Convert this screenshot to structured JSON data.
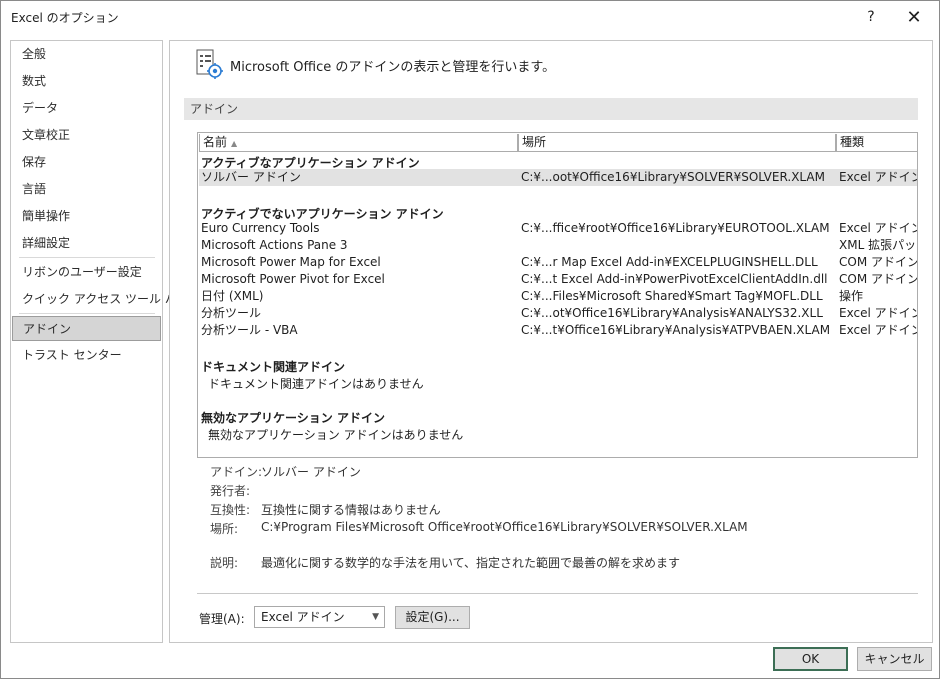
{
  "window": {
    "title": "Excel のオプション",
    "help_glyph": "?",
    "close_glyph": "✕"
  },
  "nav": {
    "items": [
      {
        "label": "全般"
      },
      {
        "label": "数式"
      },
      {
        "label": "データ"
      },
      {
        "label": "文章校正"
      },
      {
        "label": "保存"
      },
      {
        "label": "言語"
      },
      {
        "label": "簡単操作"
      },
      {
        "label": "詳細設定"
      },
      {
        "label": "リボンのユーザー設定"
      },
      {
        "label": "クイック アクセス ツール バー"
      },
      {
        "label": "アドイン",
        "active": true
      },
      {
        "label": "トラスト センター"
      }
    ]
  },
  "header": {
    "text": "Microsoft Office のアドインの表示と管理を行います。",
    "icon": "addin-settings-icon"
  },
  "section": {
    "title": "アドイン"
  },
  "table": {
    "columns": [
      "名前",
      "場所",
      "種類"
    ],
    "sort_indicator": "▲",
    "groups": {
      "active": {
        "title": "アクティブなアプリケーション アドイン",
        "rows": [
          {
            "name": "ソルバー アドイン",
            "location": "C:¥...oot¥Office16¥Library¥SOLVER¥SOLVER.XLAM",
            "type": "Excel アドイン",
            "selected": true
          }
        ]
      },
      "inactive": {
        "title": "アクティブでないアプリケーション アドイン",
        "rows": [
          {
            "name": "Euro Currency Tools",
            "location": "C:¥...ffice¥root¥Office16¥Library¥EUROTOOL.XLAM",
            "type": "Excel アドイン"
          },
          {
            "name": "Microsoft Actions Pane 3",
            "location": "",
            "type": "XML 拡張パック"
          },
          {
            "name": "Microsoft Power Map for Excel",
            "location": "C:¥...r Map Excel Add-in¥EXCELPLUGINSHELL.DLL",
            "type": "COM アドイン"
          },
          {
            "name": "Microsoft Power Pivot for Excel",
            "location": "C:¥...t Excel Add-in¥PowerPivotExcelClientAddIn.dll",
            "type": "COM アドイン"
          },
          {
            "name": "日付 (XML)",
            "location": "C:¥...Files¥Microsoft Shared¥Smart Tag¥MOFL.DLL",
            "type": "操作"
          },
          {
            "name": "分析ツール",
            "location": "C:¥...ot¥Office16¥Library¥Analysis¥ANALYS32.XLL",
            "type": "Excel アドイン"
          },
          {
            "name": "分析ツール - VBA",
            "location": "C:¥...t¥Office16¥Library¥Analysis¥ATPVBAEN.XLAM",
            "type": "Excel アドイン"
          }
        ]
      },
      "document": {
        "title": "ドキュメント関連アドイン",
        "empty": "ドキュメント関連アドインはありません"
      },
      "disabled": {
        "title": "無効なアプリケーション アドイン",
        "empty": "無効なアプリケーション アドインはありません"
      }
    }
  },
  "details": {
    "addin_label": "アドイン:",
    "addin_value": "ソルバー アドイン",
    "publisher_label": "発行者:",
    "publisher_value": "",
    "compat_label": "互換性:",
    "compat_value": "互換性に関する情報はありません",
    "location_label": "場所:",
    "location_value": "C:¥Program Files¥Microsoft Office¥root¥Office16¥Library¥SOLVER¥SOLVER.XLAM",
    "description_label": "説明:",
    "description_value": "最適化に関する数学的な手法を用いて、指定された範囲で最善の解を求めます"
  },
  "manage": {
    "label": "管理(A):",
    "selected": "Excel アドイン",
    "go_label": "設定(G)..."
  },
  "footer": {
    "ok_label": "OK",
    "cancel_label": "キャンセル"
  }
}
